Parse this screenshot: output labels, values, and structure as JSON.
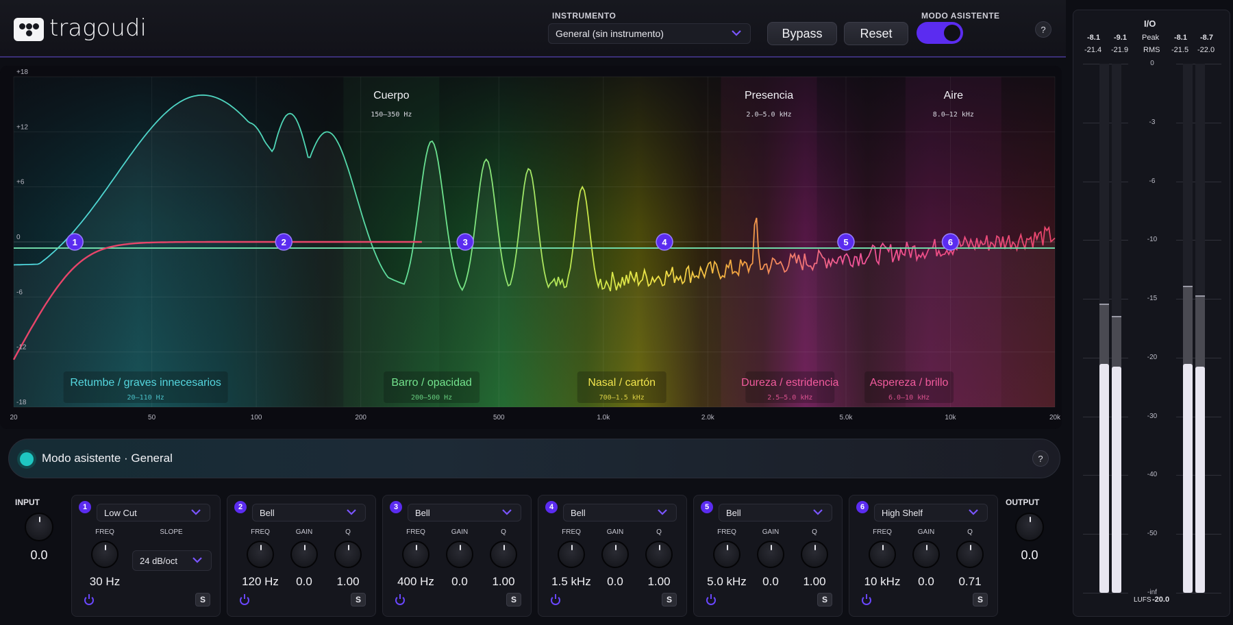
{
  "header": {
    "app_name": "tragoudi",
    "instrument_label": "INSTRUMENTO",
    "instrument_value": "General (sin instrumento)",
    "bypass_label": "Bypass",
    "reset_label": "Reset",
    "assistant_label": "MODO ASISTENTE",
    "assistant_on": true,
    "help": "?"
  },
  "graph": {
    "y_ticks": [
      "+18",
      "+12",
      "+6",
      "0",
      "-6",
      "-12",
      "-18"
    ],
    "x_ticks": [
      "20",
      "50",
      "100",
      "200",
      "500",
      "1.0k",
      "2.0k",
      "5.0k",
      "10k",
      "20k"
    ],
    "target_zones": [
      {
        "name": "Cuerpo",
        "range": "150–350 Hz",
        "color": "#2e8f4e"
      },
      {
        "name": "Presencia",
        "range": "2.0–5.0 kHz",
        "color": "#c22f8a"
      },
      {
        "name": "Aire",
        "range": "8.0–12 kHz",
        "color": "#a02f86"
      }
    ],
    "problem_zones": [
      {
        "name": "Retumbe / graves innecesarios",
        "range": "20–110 Hz",
        "color": "#4fd6de"
      },
      {
        "name": "Barro / opacidad",
        "range": "200–500 Hz",
        "color": "#6fe38a"
      },
      {
        "name": "Nasal / cartón",
        "range": "700–1.5 kHz",
        "color": "#f2e447"
      },
      {
        "name": "Dureza / estridencia",
        "range": "2.5–5.0 kHz",
        "color": "#f2559a"
      },
      {
        "name": "Aspereza / brillo",
        "range": "6.0–10 kHz",
        "color": "#f2559a"
      }
    ],
    "nodes": [
      "1",
      "2",
      "3",
      "4",
      "5",
      "6"
    ]
  },
  "assistant": {
    "title": "Modo asistente · General",
    "help": "?"
  },
  "input": {
    "label": "INPUT",
    "value": "0.0"
  },
  "output": {
    "label": "OUTPUT",
    "value": "0.0"
  },
  "bands": [
    {
      "num": "1",
      "type": "Low Cut",
      "params": [
        {
          "label": "FREQ",
          "value": "30 Hz"
        }
      ],
      "slope_label": "SLOPE",
      "slope": "24 dB/oct",
      "solo": "S"
    },
    {
      "num": "2",
      "type": "Bell",
      "params": [
        {
          "label": "FREQ",
          "value": "120 Hz"
        },
        {
          "label": "GAIN",
          "value": "0.0"
        },
        {
          "label": "Q",
          "value": "1.00"
        }
      ],
      "solo": "S"
    },
    {
      "num": "3",
      "type": "Bell",
      "params": [
        {
          "label": "FREQ",
          "value": "400 Hz"
        },
        {
          "label": "GAIN",
          "value": "0.0"
        },
        {
          "label": "Q",
          "value": "1.00"
        }
      ],
      "solo": "S"
    },
    {
      "num": "4",
      "type": "Bell",
      "params": [
        {
          "label": "FREQ",
          "value": "1.5 kHz"
        },
        {
          "label": "GAIN",
          "value": "0.0"
        },
        {
          "label": "Q",
          "value": "1.00"
        }
      ],
      "solo": "S"
    },
    {
      "num": "5",
      "type": "Bell",
      "params": [
        {
          "label": "FREQ",
          "value": "5.0 kHz"
        },
        {
          "label": "GAIN",
          "value": "0.0"
        },
        {
          "label": "Q",
          "value": "1.00"
        }
      ],
      "solo": "S"
    },
    {
      "num": "6",
      "type": "High Shelf",
      "params": [
        {
          "label": "FREQ",
          "value": "10 kHz"
        },
        {
          "label": "GAIN",
          "value": "0.0"
        },
        {
          "label": "Q",
          "value": "0.71"
        }
      ],
      "solo": "S"
    }
  ],
  "meters": {
    "title": "I/O",
    "in_peak": [
      "-8.1",
      "-9.1"
    ],
    "in_rms": [
      "-21.4",
      "-21.9"
    ],
    "out_peak": [
      "-8.1",
      "-8.7"
    ],
    "out_rms": [
      "-21.5",
      "-22.0"
    ],
    "peak_label": "Peak",
    "rms_label": "RMS",
    "scale": [
      "0",
      "-3",
      "-6",
      "-10",
      "-15",
      "-20",
      "-30",
      "-40",
      "-50",
      "-inf"
    ],
    "lufs_label": "LUFS",
    "lufs_value": "-20.0"
  },
  "colors": {
    "accent": "#5b2cf0",
    "teal": "#1fc6c1",
    "red": "#e8456a"
  }
}
